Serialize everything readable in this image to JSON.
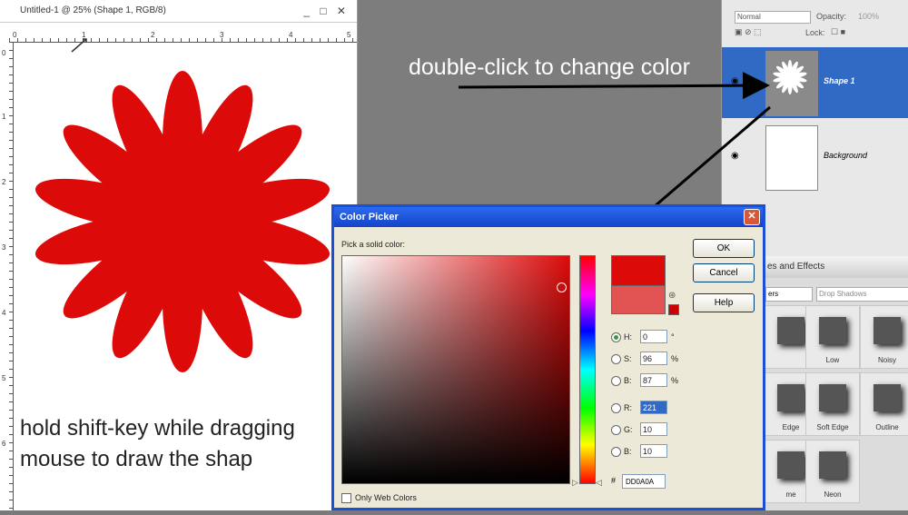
{
  "document": {
    "title": "Untitled-1 @ 25% (Shape 1, RGB/8)",
    "window_controls": "_ □ ✕",
    "ruler_top_labels": [
      "0",
      "1",
      "2",
      "3",
      "4",
      "5"
    ],
    "ruler_left_labels": [
      "0",
      "1",
      "2",
      "3",
      "4",
      "5",
      "6"
    ],
    "caption_line1": "hold shift-key while dragging",
    "caption_line2": "mouse to draw the shap",
    "shape_color": "#dd0a0a"
  },
  "annotation": {
    "text": "double-click to change color"
  },
  "layers_panel": {
    "blend_mode": "Normal",
    "opacity_label": "Opacity:",
    "opacity_value": "100%",
    "lock_label": "Lock:",
    "layers": [
      {
        "name": "Shape 1",
        "selected": true
      },
      {
        "name": "Background",
        "selected": false
      }
    ]
  },
  "effects_panel": {
    "tab_label": "es and Effects",
    "filter_value": "ers",
    "filter_dropdown": "Drop Shadows",
    "row1_labels": [
      "",
      "Low",
      "Noisy"
    ],
    "row2_labels": [
      "Edge",
      "Soft Edge",
      "Outline"
    ],
    "row3_labels": [
      "me",
      "Neon",
      ""
    ]
  },
  "color_picker": {
    "title": "Color Picker",
    "prompt": "Pick a solid color:",
    "buttons": {
      "ok": "OK",
      "cancel": "Cancel",
      "help": "Help"
    },
    "fields": {
      "h": {
        "label": "H:",
        "value": "0",
        "unit": "°"
      },
      "s": {
        "label": "S:",
        "value": "96",
        "unit": "%"
      },
      "b": {
        "label": "B:",
        "value": "87",
        "unit": "%"
      },
      "r": {
        "label": "R:",
        "value": "221"
      },
      "g": {
        "label": "G:",
        "value": "10"
      },
      "bl": {
        "label": "B:",
        "value": "10"
      }
    },
    "hex_label": "#",
    "hex_value": "DD0A0A",
    "only_web_colors": "Only Web Colors",
    "selected_color": "#dd0a0a",
    "previous_color": "#e25353"
  }
}
